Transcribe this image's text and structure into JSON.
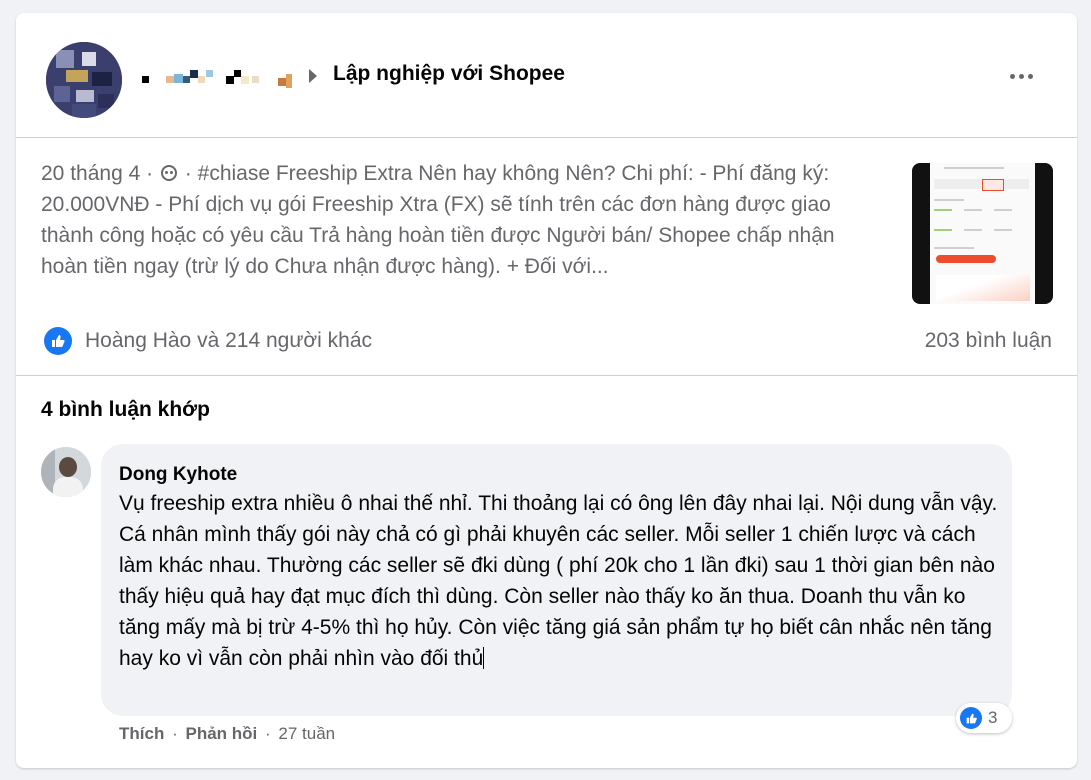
{
  "post": {
    "author_name_obscured": "",
    "group_name": "Lập nghiệp với Shopee",
    "timestamp": "20 tháng 4",
    "separator": "·",
    "excerpt": "#chiase Freeship Extra Nên hay không Nên? Chi phí: - Phí đăng ký: 20.000VNĐ - Phí dịch vụ gói Freeship Xtra (FX) sẽ tính trên các đơn hàng được giao thành công hoặc có yêu cầu Trả hàng hoàn tiền được Người bán/ Shopee chấp nhận hoàn tiền ngay (trừ lý do Chưa nhận được hàng). + Đối với...",
    "reactors": "Hoàng Hào và 214 người khác",
    "comment_count": "203 bình luận"
  },
  "matched": {
    "title": "4 bình luận khớp"
  },
  "comment": {
    "author": "Dong Kyhote",
    "text": "Vụ freeship extra nhiều ô nhai thế nhỉ. Thi thoảng lại có ông lên đây nhai lại. Nội dung vẫn vậy. Cá nhân mình thấy gói này chả có gì phải khuyên các seller. Mỗi seller 1 chiến lược và cách làm khác nhau. Thường các seller sẽ đki dùng ( phí 20k cho 1 lần đki) sau 1 thời gian bên nào thấy hiệu quả hay đạt mục đích thì dùng. Còn seller nào thấy ko ăn thua. Doanh thu vẫn ko tăng mấy mà bị trừ 4-5% thì họ hủy. Còn việc tăng giá sản phẩm tự họ biết cân nhắc nên tăng hay ko vì vẫn còn phải nhìn vào đối thủ",
    "reaction_count": "3",
    "like_label": "Thích",
    "reply_label": "Phản hồi",
    "dot": "·",
    "age": "27 tuần"
  },
  "icons": {
    "more": "more-icon",
    "like": "like-icon",
    "privacy": "group-privacy-icon",
    "breadcrumb": "caret-right-icon"
  },
  "colors": {
    "accent": "#1877f2",
    "secondary_text": "#65676b",
    "bubble": "#f0f2f5",
    "page_bg": "#f0f2f5"
  }
}
